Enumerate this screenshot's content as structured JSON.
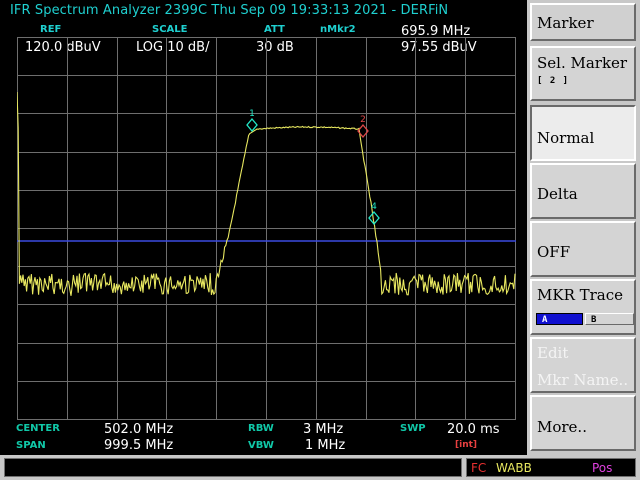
{
  "header": {
    "title": "IFR Spectrum Analyzer 2399C Thu Sep 09 19:33:13 2021 -  DERFiN"
  },
  "params": {
    "ref_label": "REF",
    "ref_value": "120.0 dBuV",
    "scale_label": "SCALE",
    "scale_value": "LOG 10 dB/",
    "att_label": "ATT",
    "att_value": "30 dB",
    "mkr_label": "nMkr2",
    "mkr_freq": "695.9 MHz",
    "mkr_level": "97.55 dBuV"
  },
  "footer": {
    "center_label": "CENTER",
    "center_value": "502.0 MHz",
    "span_label": "SPAN",
    "span_value": "999.5 MHz",
    "rbw_label": "RBW",
    "rbw_value": "3 MHz",
    "vbw_label": "VBW",
    "vbw_value": "1 MHz",
    "swp_label": "SWP",
    "swp_value": "20.0 ms",
    "swp_mode": "[int]"
  },
  "markers": [
    {
      "id": "1",
      "color": "#22e8c8"
    },
    {
      "id": "2",
      "color": "#e04848"
    },
    {
      "id": "4",
      "color": "#22e8c8"
    }
  ],
  "softkeys": {
    "marker": "Marker",
    "sel_marker": "Sel. Marker",
    "sel_marker_sub": "[ 2 ]",
    "normal": "Normal",
    "delta": "Delta",
    "off": "OFF",
    "mkr_trace": "MKR Trace",
    "trace_a": "A",
    "trace_b": "B",
    "edit_line1": "Edit",
    "edit_line2": "Mkr Name..",
    "more": "More.."
  },
  "status": {
    "message": "",
    "fc": "FC",
    "wabb": "WABB",
    "pos": "Pos"
  },
  "colors": {
    "trace": "#e8e860",
    "threshold_line": "#3a4ae0",
    "grid": "#6e6e6e",
    "label_cyan": "#1fd0d0",
    "fc": "#e83030",
    "wabb": "#e8e860",
    "pos": "#e040e0"
  },
  "icons": {
    "marker_shape": "diamond-marker-icon"
  }
}
